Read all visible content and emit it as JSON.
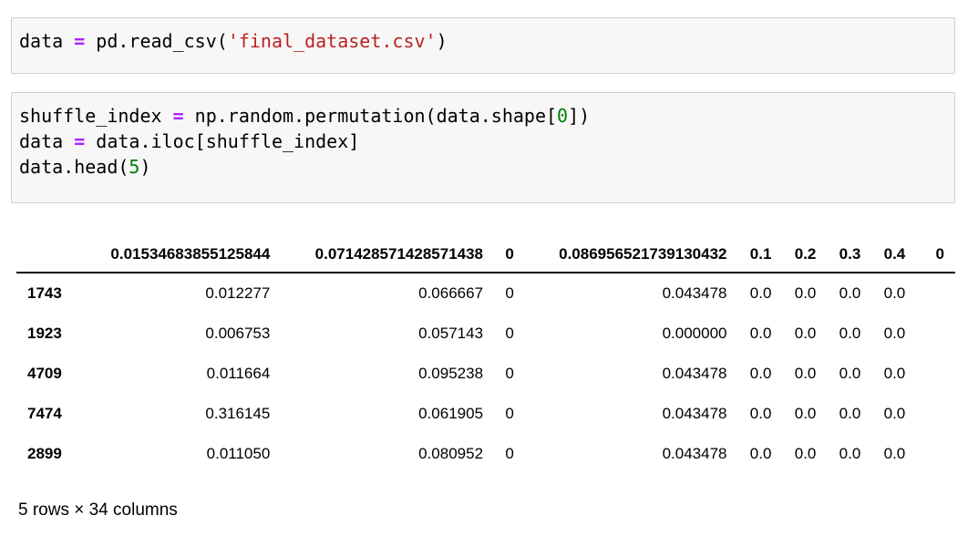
{
  "cells": [
    {
      "tokens": [
        {
          "t": "data ",
          "c": ""
        },
        {
          "t": "=",
          "c": "op"
        },
        {
          "t": " pd.read_csv(",
          "c": ""
        },
        {
          "t": "'final_dataset.csv'",
          "c": "str"
        },
        {
          "t": ")",
          "c": ""
        }
      ]
    },
    {
      "lines": [
        [
          {
            "t": "shuffle_index ",
            "c": ""
          },
          {
            "t": "=",
            "c": "op"
          },
          {
            "t": " np.random.permutation(data.shape[",
            "c": ""
          },
          {
            "t": "0",
            "c": "num"
          },
          {
            "t": "])",
            "c": ""
          }
        ],
        [
          {
            "t": "data ",
            "c": ""
          },
          {
            "t": "=",
            "c": "op"
          },
          {
            "t": " data.iloc[shuffle_index]",
            "c": ""
          }
        ],
        [
          {
            "t": "data.head(",
            "c": ""
          },
          {
            "t": "5",
            "c": "num"
          },
          {
            "t": ")",
            "c": ""
          }
        ]
      ]
    }
  ],
  "table": {
    "columns": [
      "",
      "0.01534683855125844",
      "0.071428571428571438",
      "0",
      "0.086956521739130432",
      "0.1",
      "0.2",
      "0.3",
      "0.4",
      "0"
    ],
    "rows": [
      {
        "index": "1743",
        "cells": [
          "0.012277",
          "0.066667",
          "0",
          "0.043478",
          "0.0",
          "0.0",
          "0.0",
          "0.0"
        ]
      },
      {
        "index": "1923",
        "cells": [
          "0.006753",
          "0.057143",
          "0",
          "0.000000",
          "0.0",
          "0.0",
          "0.0",
          "0.0"
        ]
      },
      {
        "index": "4709",
        "cells": [
          "0.011664",
          "0.095238",
          "0",
          "0.043478",
          "0.0",
          "0.0",
          "0.0",
          "0.0"
        ]
      },
      {
        "index": "7474",
        "cells": [
          "0.316145",
          "0.061905",
          "0",
          "0.043478",
          "0.0",
          "0.0",
          "0.0",
          "0.0"
        ]
      },
      {
        "index": "2899",
        "cells": [
          "0.011050",
          "0.080952",
          "0",
          "0.043478",
          "0.0",
          "0.0",
          "0.0",
          "0.0"
        ]
      }
    ]
  },
  "footer": "5 rows × 34 columns"
}
